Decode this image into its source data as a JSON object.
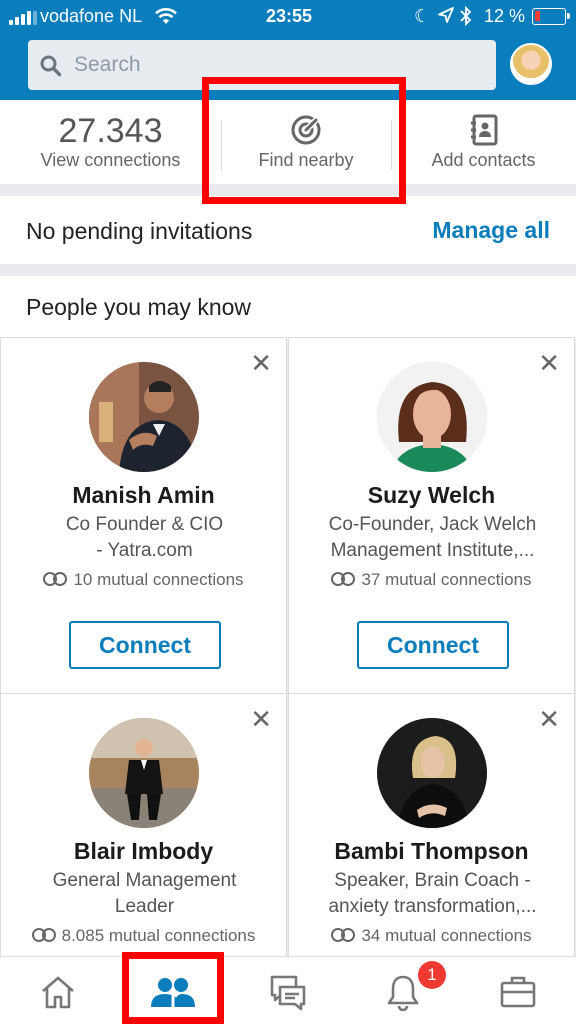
{
  "status_bar": {
    "carrier": "vodafone NL",
    "time": "23:55",
    "battery": "12 %"
  },
  "search": {
    "placeholder": "Search"
  },
  "stats": {
    "connections_count": "27.343",
    "connections_label": "View connections",
    "find_nearby_label": "Find nearby",
    "add_contacts_label": "Add contacts"
  },
  "invitations": {
    "text": "No pending invitations",
    "manage_label": "Manage all"
  },
  "pymk": {
    "title": "People you may know",
    "people": [
      {
        "name": "Manish Amin",
        "headline_1": "Co Founder & CIO",
        "headline_2": "- Yatra.com",
        "mutual": "10 mutual connections",
        "button": "Connect"
      },
      {
        "name": "Suzy Welch",
        "headline_1": "Co-Founder, Jack Welch",
        "headline_2": "Management Institute,...",
        "mutual": "37 mutual connections",
        "button": "Connect"
      },
      {
        "name": "Blair Imbody",
        "headline_1": "General Management",
        "headline_2": "Leader",
        "mutual": "8.085 mutual connections"
      },
      {
        "name": "Bambi Thompson",
        "headline_1": "Speaker, Brain Coach -",
        "headline_2": "anxiety transformation,...",
        "mutual": "34 mutual connections"
      }
    ]
  },
  "tabbar": {
    "notifications_badge": "1",
    "active_tab": "my-network",
    "accent": "#0a7dbd"
  },
  "annotation_color": "#ff0000"
}
